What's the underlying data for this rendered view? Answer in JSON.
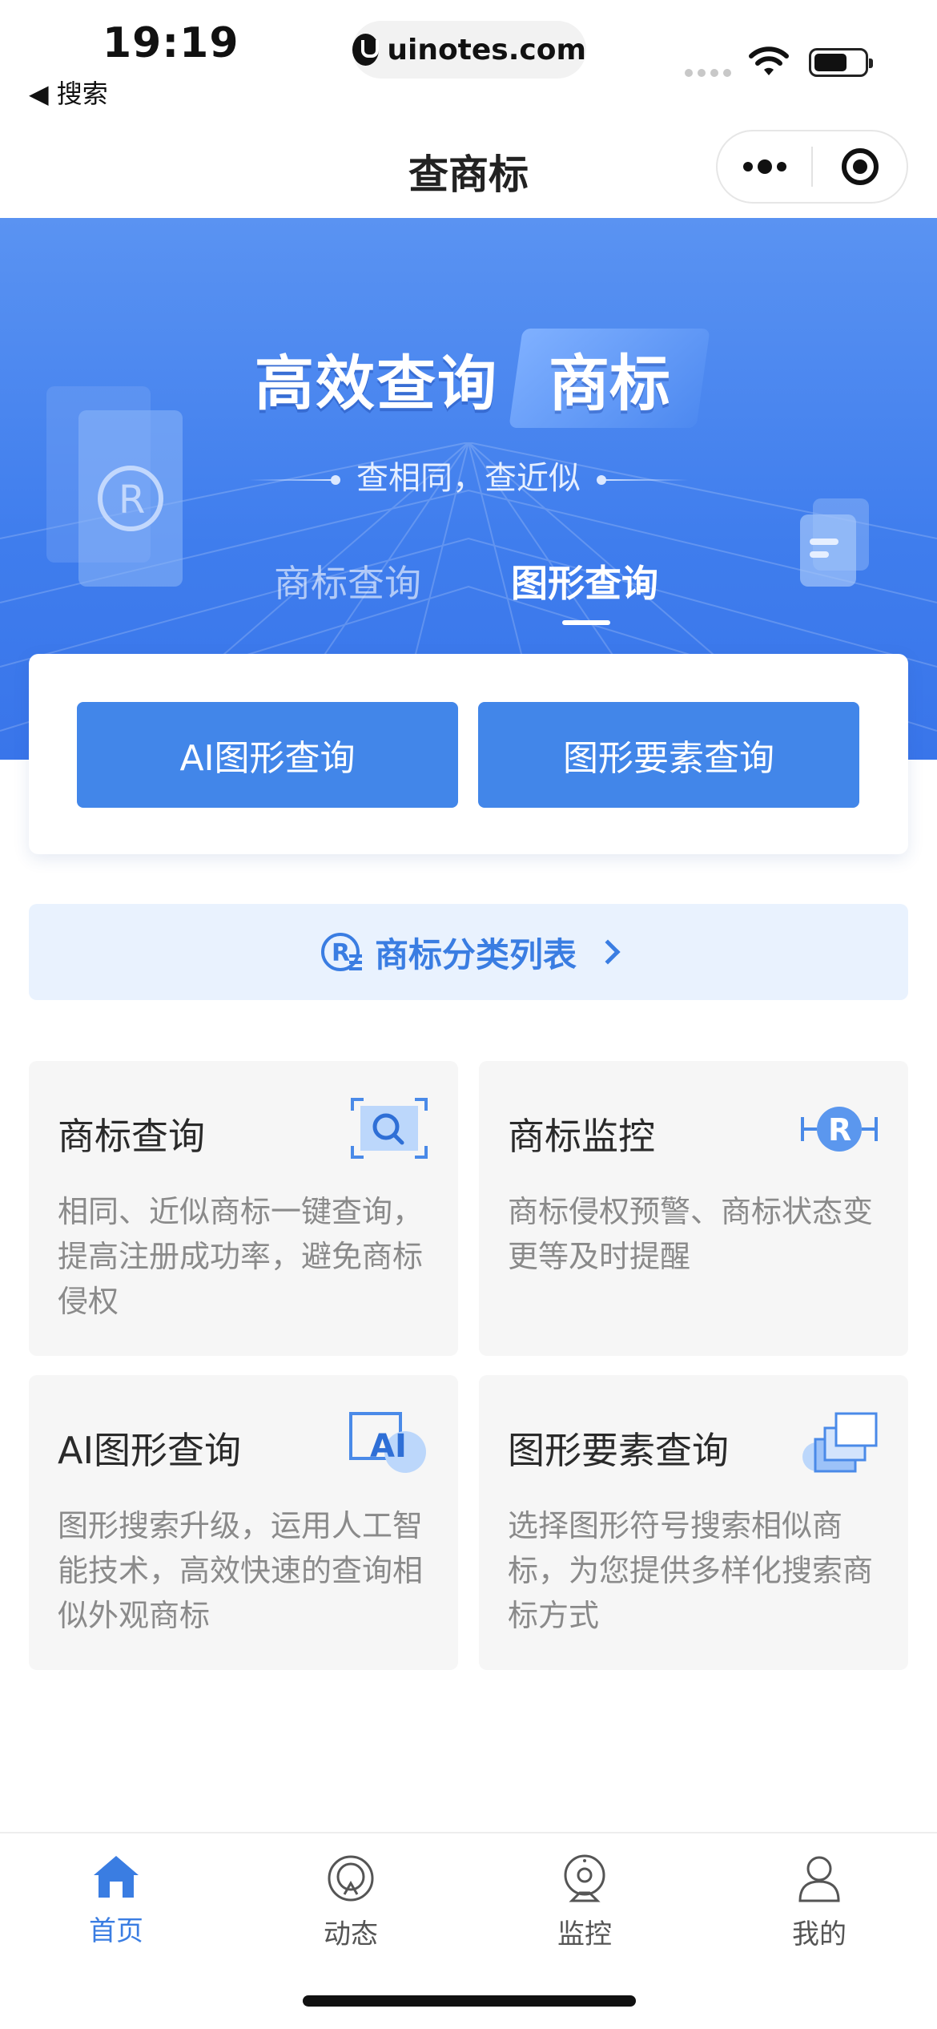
{
  "status": {
    "time": "19:19",
    "back_label": "◀ 搜索",
    "url": "uinotes.com"
  },
  "nav": {
    "title": "查商标"
  },
  "hero": {
    "title_main": "高效查询",
    "title_highlight": "商标",
    "subtitle": "查相同，查近似",
    "tabs": [
      "商标查询",
      "图形查询"
    ],
    "active_tab": "图形查询"
  },
  "query": {
    "btn_ai": "AI图形查询",
    "btn_element": "图形要素查询"
  },
  "category": {
    "label": "商标分类列表"
  },
  "features": [
    {
      "title": "商标查询",
      "desc": "相同、近似商标一键查询，提高注册成功率，避免商标侵权",
      "icon": "search-frame-icon"
    },
    {
      "title": "商标监控",
      "desc": "商标侵权预警、商标状态变更等及时提醒",
      "icon": "registered-monitor-icon"
    },
    {
      "title": "AI图形查询",
      "desc": "图形搜索升级，运用人工智能技术，高效快速的查询相似外观商标",
      "icon": "ai-icon"
    },
    {
      "title": "图形要素查询",
      "desc": "选择图形符号搜索相似商标，为您提供多样化搜索商标方式",
      "icon": "stacked-shapes-icon"
    }
  ],
  "tabbar": {
    "items": [
      {
        "label": "首页",
        "icon": "home-icon",
        "active": true
      },
      {
        "label": "动态",
        "icon": "news-icon",
        "active": false
      },
      {
        "label": "监控",
        "icon": "camera-icon",
        "active": false
      },
      {
        "label": "我的",
        "icon": "user-icon",
        "active": false
      }
    ]
  },
  "colors": {
    "primary": "#4286e9",
    "hero_top": "#5a93f2",
    "hero_bottom": "#3975ea",
    "accent_text": "#3a7de2",
    "card_bg": "#f6f6f6"
  }
}
